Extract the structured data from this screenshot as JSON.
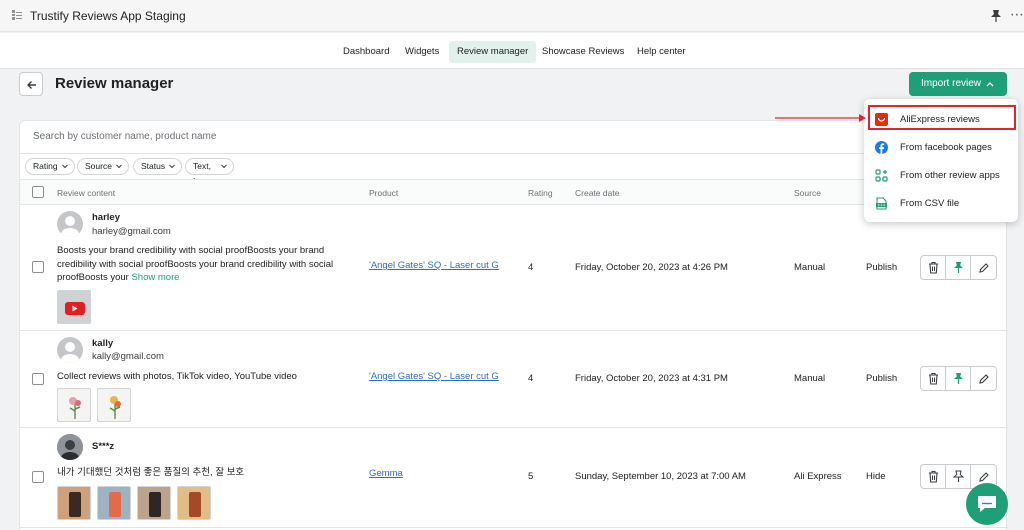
{
  "app": {
    "title": "Trustify Reviews App Staging"
  },
  "nav": {
    "tabs": [
      {
        "label": "Dashboard"
      },
      {
        "label": "Widgets"
      },
      {
        "label": "Review manager"
      },
      {
        "label": "Showcase Reviews"
      },
      {
        "label": "Help center"
      }
    ],
    "active": "Review manager"
  },
  "page": {
    "title": "Review manager",
    "import_label": "Import review"
  },
  "search": {
    "placeholder": "Search by customer name, product name"
  },
  "filters": [
    "Rating",
    "Source",
    "Status",
    "Text, Image"
  ],
  "table": {
    "headers": {
      "content": "Review content",
      "product": "Product",
      "rating": "Rating",
      "date": "Create date",
      "source": "Source"
    },
    "rows": [
      {
        "name": "harley",
        "email": "harley@gmail.com",
        "text": "Boosts your brand credibility with social proofBoosts your brand credibility with social proofBoosts your brand credibility with social proofBoosts your",
        "show_more": "Show more",
        "product": "'Angel Gates' SQ - Laser cut G",
        "rating": "4",
        "date": "Friday, October 20, 2023 at 4:26 PM",
        "source": "Manual",
        "status": "Publish",
        "media": [
          "youtube-thumb"
        ]
      },
      {
        "name": "kally",
        "email": "kally@gmail.com",
        "text": "Collect reviews with photos, TikTok video, YouTube video",
        "product": "'Angel Gates' SQ - Laser cut G",
        "rating": "4",
        "date": "Friday, October 20, 2023 at 4:31 PM",
        "source": "Manual",
        "status": "Publish",
        "media": [
          "flower-photo",
          "flower-photo"
        ]
      },
      {
        "name": "S***z",
        "text": "내가 기대했던 것처럼 좋은 품질의 추천, 잘 보호",
        "product": "Gemma",
        "rating": "5",
        "date": "Sunday, September 10, 2023 at 7:00 AM",
        "source": "Ali Express",
        "status": "Hide",
        "media": [
          "product-photo",
          "product-photo",
          "product-photo",
          "product-photo"
        ]
      }
    ]
  },
  "dropdown": {
    "items": [
      {
        "label": "AliExpress reviews",
        "icon": "aliexpress-icon"
      },
      {
        "label": "From facebook pages",
        "icon": "facebook-icon"
      },
      {
        "label": "From other review apps",
        "icon": "apps-icon"
      },
      {
        "label": "From CSV file",
        "icon": "csv-icon"
      }
    ]
  },
  "colors": {
    "primary": "#1f9f77",
    "highlight": "#e0252e",
    "link": "#2c6ecb",
    "facebook": "#1877f2",
    "aliexpress": "#e62e04"
  }
}
